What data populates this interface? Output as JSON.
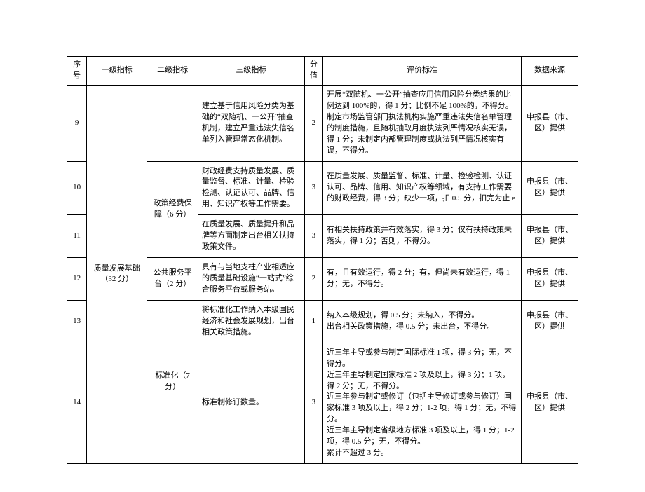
{
  "headers": {
    "seq": "序号",
    "level1": "一级指标",
    "level2": "二级指标",
    "level3": "三级指标",
    "score": "分值",
    "standard": "评价标准",
    "source": "数据来源"
  },
  "level1_groups": {
    "quality_base": "质量发展基础（32 分）"
  },
  "level2_groups": {
    "policy_fund": "政策经费保障（6 分）",
    "public_platform": "公共服务平台（2 分）",
    "standardization": "标准化（7 分）"
  },
  "rows": [
    {
      "seq": "9",
      "level3": "建立基于信用风险分类为基础的“双随机、一公开”抽查机制，建立严重违法失信名单列入管理常态化机制。",
      "score": "2",
      "standard": "开展“双随机、一公开”抽查应用信用风险分类结果的比例达到 100%的，得 1 分；比例不足 100%的，不得分。\n制定市场监管部门执法机构实施严重违法失信名单管理的制度措施，且随机抽取月度执法列严情况核实无误，得 1 分；未制定内部管理制度或执法列严情况核实有误，不得分。",
      "source": "申报县（市、区）提供"
    },
    {
      "seq": "10",
      "level3": "财政经费支持质量发展、质量监督、标准、计量、检验检测、认证认可、品牌、信用、知识产权等工作需要。",
      "score": "3",
      "standard": "在质量发展、质量监督、标准、计量、检验检测、认证认可、品牌、信用、知识产权等领域，有支持工作需要的财政经费，得 3 分；缺少一项，扣 0.5 分，扣完为止 e",
      "source": "申报县（市、区）提供"
    },
    {
      "seq": "11",
      "level3": "在质量发展、质量提升和品牌等方面制定出台相关扶持政策文件。",
      "score": "3",
      "standard": "有相关扶持政策并有效落实，得 3 分；仅有扶持政策未落实，得 1 分；否则，不得分。",
      "source": "申报县（市、区）提供"
    },
    {
      "seq": "12",
      "level3": "具有与当地支柱产业相适应的质量基础设施“一站式”综合服务平台或服务站。",
      "score": "2",
      "standard": "有，且有效运行，得 2 分；有，但尚未有效运行，得 1 分；无，不得分。",
      "source": "申报县（市、区）提供"
    },
    {
      "seq": "13",
      "level3": "将标准化工作纳入本级国民经济和社会发展规划，出台相关政策措施。",
      "score": "1",
      "standard": "纳入本级规划，得 0.5 分；未纳入，不得分。\n出台相关政策措施，得 0.5 分；未出台，不得分。",
      "source": "申报县（市、区）提供"
    },
    {
      "seq": "14",
      "level3": "标准制修订数量。",
      "score": "3",
      "standard": "近三年主导或参与制定国际标准 1 项，得 3 分；无，不得分。\n近三年主导制定国家标准 2 项及以上，得 3 分；1 项，得 2 分；无，不得分。\n近三年参与制定或修订（包括主导修订或参与修订）国家标准 3 项及以上，得 2 分；1-2 项，得 1 分；无，不得分。\n近三年主导制定省级地方标准 3 项及以上，得 1 分；1-2 项，得 0.5 分；无，不得分。\n累计不超过 3 分。",
      "source": "申报县（市、区）提供"
    }
  ]
}
